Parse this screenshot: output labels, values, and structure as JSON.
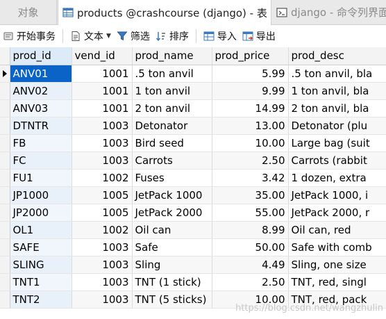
{
  "tabs": {
    "objects": "对象",
    "table": "products @crashcourse (django) - 表",
    "query": "django - 命令列界面"
  },
  "toolbar": {
    "begin_transaction": "开始事务",
    "text": "文本",
    "filter": "筛选",
    "sort": "排序",
    "import": "导入",
    "export": "导出"
  },
  "grid": {
    "columns": [
      "prod_id",
      "vend_id",
      "prod_name",
      "prod_price",
      "prod_desc"
    ],
    "rows": [
      [
        "ANV01",
        "1001",
        ".5 ton anvil",
        "5.99",
        ".5 ton anvil, bla"
      ],
      [
        "ANV02",
        "1001",
        "1 ton anvil",
        "9.99",
        "1 ton anvil, bla"
      ],
      [
        "ANV03",
        "1001",
        "2 ton anvil",
        "14.99",
        "2 ton anvil, bla"
      ],
      [
        "DTNTR",
        "1003",
        "Detonator",
        "13.00",
        "Detonator (plu"
      ],
      [
        "FB",
        "1003",
        "Bird seed",
        "10.00",
        "Large bag (suit"
      ],
      [
        "FC",
        "1003",
        "Carrots",
        "2.50",
        "Carrots (rabbit"
      ],
      [
        "FU1",
        "1002",
        "Fuses",
        "3.42",
        "1 dozen, extra"
      ],
      [
        "JP1000",
        "1005",
        "JetPack 1000",
        "35.00",
        "JetPack 1000, i"
      ],
      [
        "JP2000",
        "1005",
        "JetPack 2000",
        "55.00",
        "JetPack 2000, r"
      ],
      [
        "OL1",
        "1002",
        "Oil can",
        "8.99",
        "Oil can, red"
      ],
      [
        "SAFE",
        "1003",
        "Safe",
        "50.00",
        "Safe with comb"
      ],
      [
        "SLING",
        "1003",
        "Sling",
        "4.49",
        "Sling, one size"
      ],
      [
        "TNT1",
        "1003",
        "TNT (1 stick)",
        "2.50",
        "TNT, red, singl"
      ],
      [
        "TNT2",
        "1003",
        "TNT (5 sticks)",
        "10.00",
        "TNT, red, pack"
      ]
    ]
  },
  "watermark": "https://blog.csdn.net/wangzhulin",
  "colors": {
    "selection": "#0a64c8",
    "header_bg": "#f3f3f3",
    "tab_bg": "#e9e9e9"
  }
}
